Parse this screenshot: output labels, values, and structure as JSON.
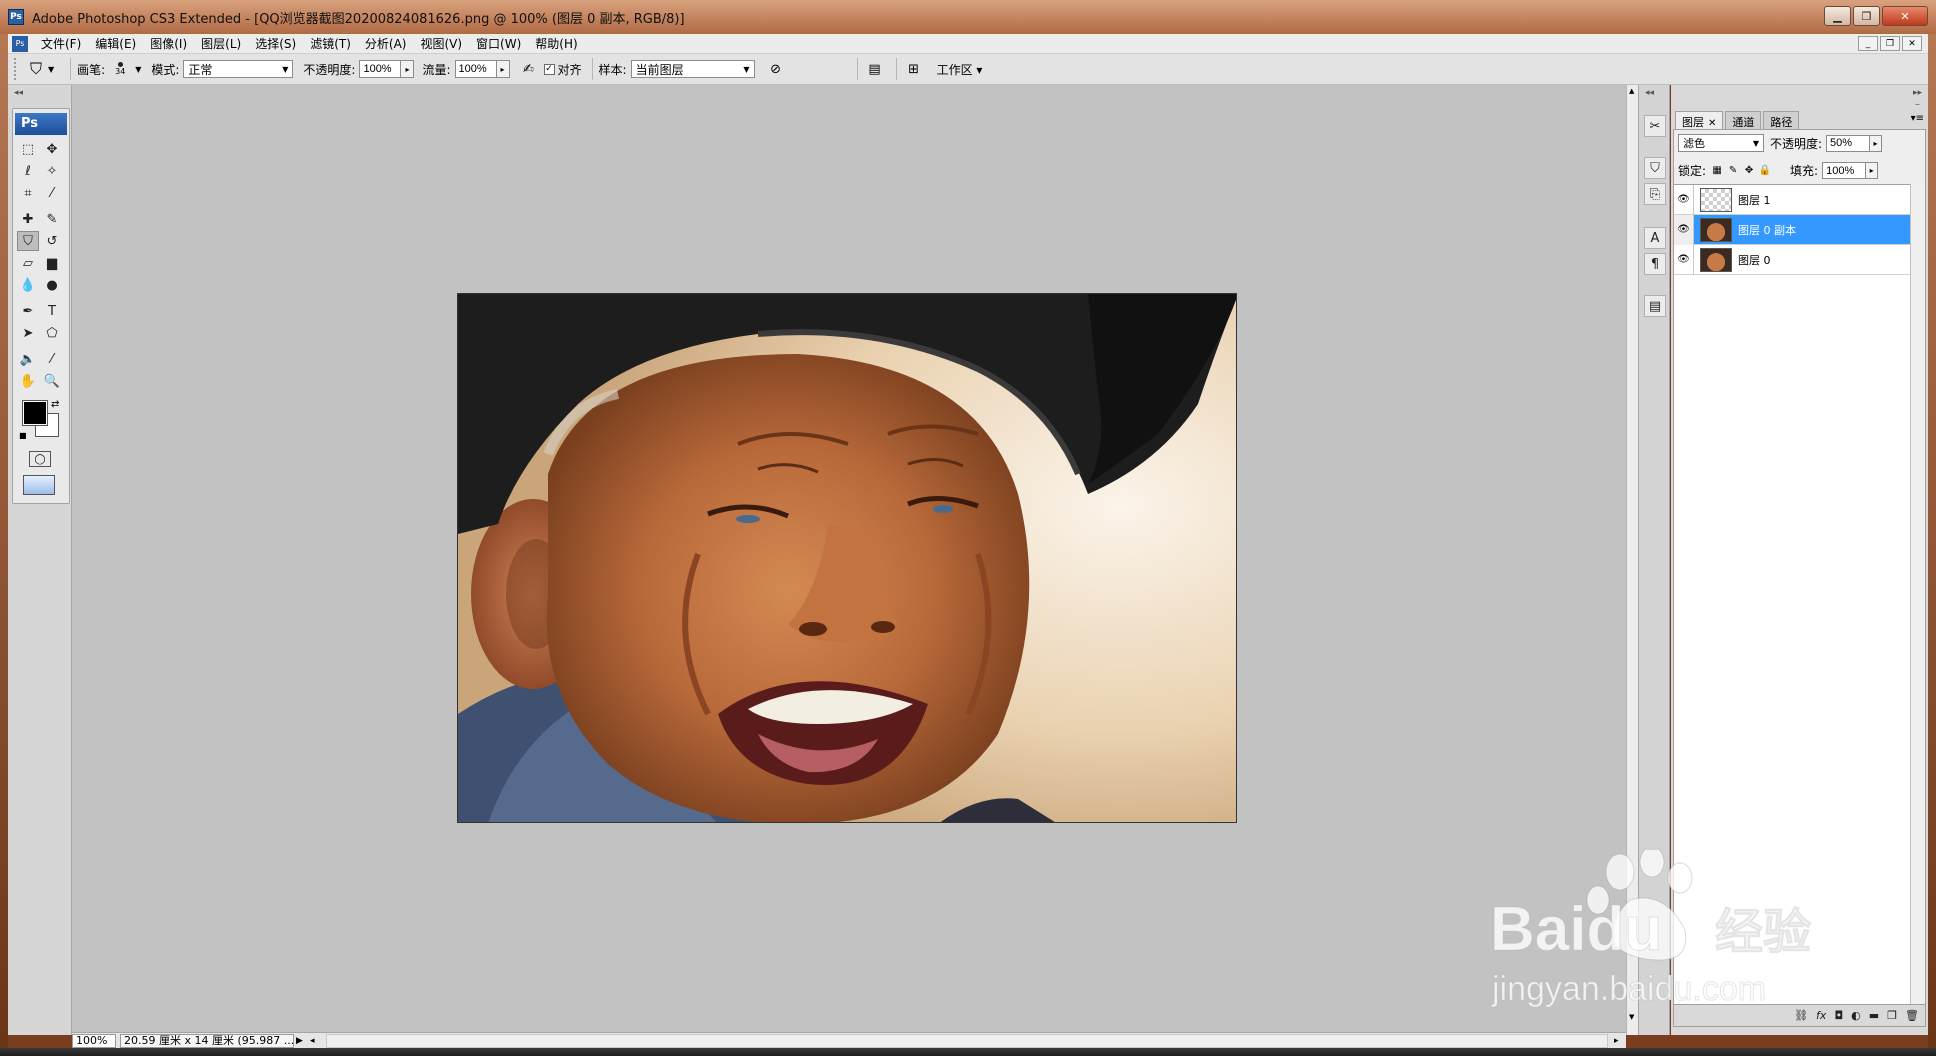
{
  "window": {
    "title": "Adobe Photoshop CS3 Extended - [QQ浏览器截图20200824081626.png @ 100% (图层 0 副本, RGB/8)]",
    "app_icon": "Ps"
  },
  "menu": {
    "items": [
      "文件(F)",
      "编辑(E)",
      "图像(I)",
      "图层(L)",
      "选择(S)",
      "滤镜(T)",
      "分析(A)",
      "视图(V)",
      "窗口(W)",
      "帮助(H)"
    ]
  },
  "options": {
    "brush_label": "画笔:",
    "brush_size": "34",
    "mode_label": "模式:",
    "mode_value": "正常",
    "opacity_label": "不透明度:",
    "opacity_value": "100%",
    "flow_label": "流量:",
    "flow_value": "100%",
    "aligned_label": "对齐",
    "sample_label": "样本:",
    "sample_value": "当前图层",
    "workspace_label": "工作区 ▾"
  },
  "toolbox": {
    "logo": "Ps"
  },
  "status": {
    "zoom": "100%",
    "doc_info": "20.59 厘米 x 14 厘米 (95.987 ..."
  },
  "layers_panel": {
    "tabs": [
      "图层",
      "通道",
      "路径"
    ],
    "blend_mode": "滤色",
    "opacity_label": "不透明度:",
    "opacity_value": "50%",
    "lock_label": "锁定:",
    "fill_label": "填充:",
    "fill_value": "100%",
    "layers": [
      {
        "name": "图层 1",
        "selected": false
      },
      {
        "name": "图层 0 副本",
        "selected": true
      },
      {
        "name": "图层 0",
        "selected": false
      }
    ]
  },
  "watermark": {
    "brand": "Baidu",
    "brand_cn": "经验",
    "url": "jingyan.baidu.com"
  },
  "colors": {
    "selection": "#3399ff",
    "foreground": "#000000",
    "background": "#ffffff"
  }
}
